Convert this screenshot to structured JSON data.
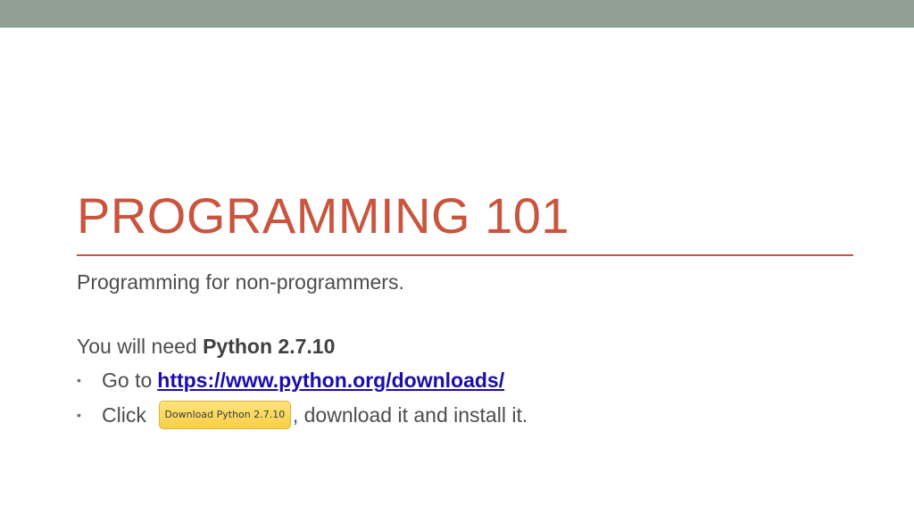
{
  "slide": {
    "title": "PROGRAMMING 101",
    "subtitle": "Programming for non-programmers.",
    "need_prefix": "You will need ",
    "need_bold": "Python 2.7.10",
    "bullets": {
      "goto_prefix": "Go to",
      "link_text": "https://www.python.org/downloads/",
      "click_prefix": "Click",
      "button_label": "Download Python 2.7.10",
      "click_suffix": ", download it and install it."
    },
    "bullet_glyph": "•"
  },
  "colors": {
    "top_bar": "#909e94",
    "title": "#c9553f",
    "rule": "#c9553f",
    "link": "#1a0dab",
    "button": "#f5cf45"
  }
}
